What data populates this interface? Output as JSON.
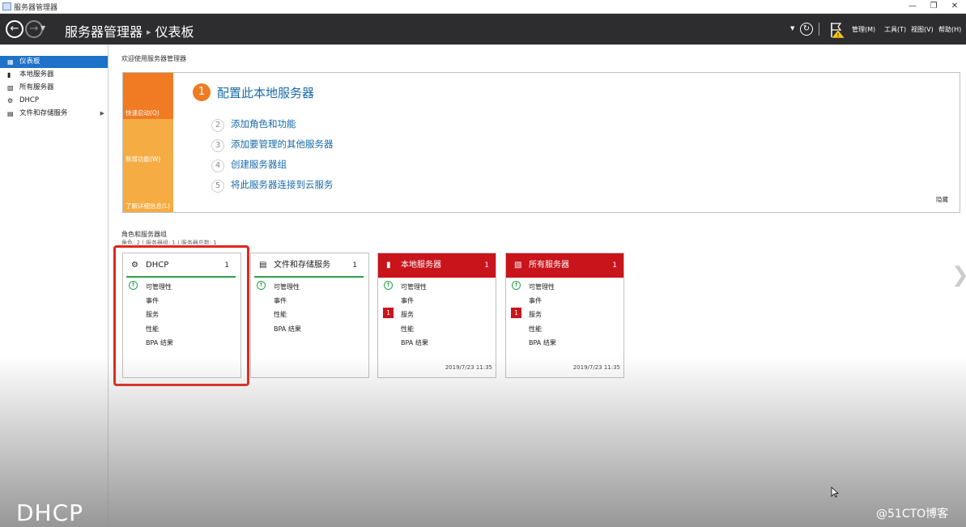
{
  "window": {
    "title": "服务器管理器",
    "minimize": "—",
    "restore": "❐",
    "close": "✕"
  },
  "header": {
    "breadcrumb_app": "服务器管理器",
    "breadcrumb_sep": "▸",
    "breadcrumb_page": "仪表板",
    "menus": [
      "管理(M)",
      "工具(T)",
      "视图(V)",
      "帮助(H)"
    ]
  },
  "sidebar": {
    "items": [
      {
        "label": "仪表板",
        "icon": "dashboard-icon",
        "active": true
      },
      {
        "label": "本地服务器",
        "icon": "server-icon"
      },
      {
        "label": "所有服务器",
        "icon": "servers-icon"
      },
      {
        "label": "DHCP",
        "icon": "dhcp-icon"
      },
      {
        "label": "文件和存储服务",
        "icon": "storage-icon",
        "expandable": true
      }
    ]
  },
  "welcome": {
    "title": "欢迎使用服务器管理器",
    "tabs": [
      "快速启动(Q)",
      "新增功能(W)",
      "了解详细信息(L)"
    ],
    "main_step": {
      "num": "1",
      "label": "配置此本地服务器"
    },
    "steps": [
      {
        "num": "2",
        "label": "添加角色和功能"
      },
      {
        "num": "3",
        "label": "添加要管理的其他服务器"
      },
      {
        "num": "4",
        "label": "创建服务器组"
      },
      {
        "num": "5",
        "label": "将此服务器连接到云服务"
      }
    ],
    "hide": "隐藏"
  },
  "roles": {
    "title": "角色和服务器组",
    "subtitle": "角色: 2 | 服务器组: 1 | 服务器总数: 1",
    "tiles": [
      {
        "name": "DHCP",
        "count": "1",
        "status": "ok",
        "rows": [
          "可管理性",
          "事件",
          "服务",
          "性能",
          "BPA 结果"
        ],
        "time": ""
      },
      {
        "name": "文件和存储服务",
        "count": "1",
        "status": "ok",
        "rows": [
          "可管理性",
          "事件",
          "性能",
          "BPA 结果"
        ],
        "time": ""
      },
      {
        "name": "本地服务器",
        "count": "1",
        "status": "alert",
        "rows": [
          "可管理性",
          "事件",
          "服务",
          "性能",
          "BPA 结果"
        ],
        "service_badge": "1",
        "time": "2019/7/23 11:35"
      },
      {
        "name": "所有服务器",
        "count": "1",
        "status": "alert",
        "rows": [
          "可管理性",
          "事件",
          "服务",
          "性能",
          "BPA 结果"
        ],
        "service_badge": "1",
        "time": "2019/7/23 11:35"
      }
    ]
  },
  "overlay": {
    "caption": "DHCP",
    "watermark": "@51CTO博客"
  },
  "colors": {
    "accent_orange": "#f07b22",
    "alert_red": "#c9141b",
    "ok_green": "#2aa14a",
    "link_blue": "#1a6aa8",
    "header_dark": "#2d2d30"
  }
}
